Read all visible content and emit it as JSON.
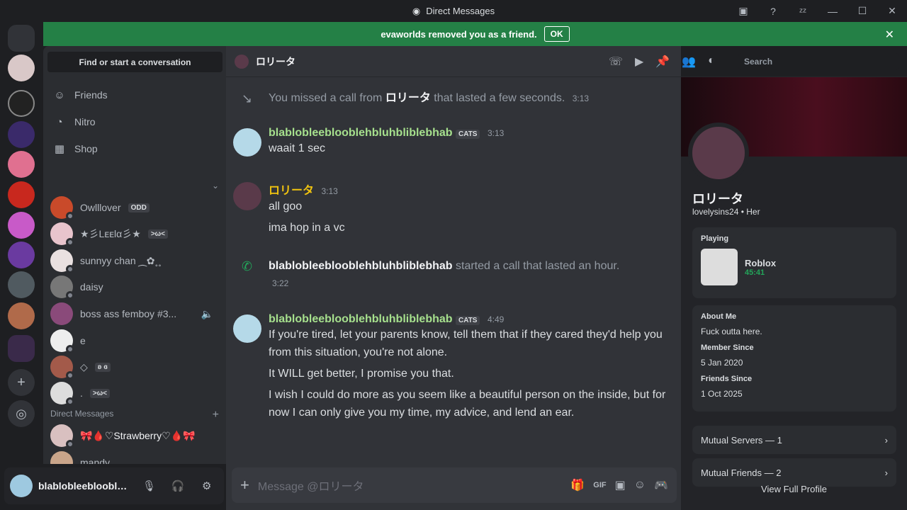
{
  "window": {
    "title": "Direct Messages"
  },
  "banner": {
    "text": "evaworlds removed you as a friend.",
    "ok": "OK"
  },
  "sidebar": {
    "search": "Find or start a conversation",
    "nav": [
      {
        "label": "Friends",
        "icon": "friends-icon"
      },
      {
        "label": "Nitro",
        "icon": "nitro-icon"
      },
      {
        "label": "Shop",
        "icon": "shop-icon"
      }
    ],
    "section_label": "Direct Messages",
    "friends": [
      {
        "name": "Owlllover",
        "tag": "ODD",
        "color": "#c94a2a"
      },
      {
        "name": "★彡Lᴇᴇlα彡★",
        "tag": ">ω<",
        "color": "#e8c4cc"
      },
      {
        "name": "sunnyy chan ⁔✿˳˳",
        "tag": "",
        "color": "#e9e0e0"
      },
      {
        "name": "daisy",
        "tag": "",
        "color": "#777"
      },
      {
        "name": "boss ass femboy #3...",
        "tag": "",
        "color": "#8a4a7a"
      },
      {
        "name": "e",
        "tag": "",
        "color": "#eee"
      },
      {
        "name": "◇",
        "tag": "ʚ ɞ",
        "color": "#a35a4a"
      },
      {
        "name": ".",
        "tag": ">ω<",
        "color": "#ddd"
      },
      {
        "name": "🎀🩸♡Strawberry♡🩸🎀",
        "tag": "",
        "color": "#d9c0c0"
      },
      {
        "name": "mandy",
        "tag": "",
        "color": "#c9a58a"
      }
    ]
  },
  "user_panel": {
    "name": "blablobleeblooblehbluhbliblebhab"
  },
  "chat": {
    "header_name": "ロリータ",
    "search_placeholder": "Search",
    "missed_call": {
      "prefix": "You missed a call from",
      "name": "ロリータ",
      "suffix": "that lasted a few seconds.",
      "time": "3:13"
    },
    "msg1": {
      "author": "blablobleeblooblehbluhbliblebhab",
      "badge": "CATS",
      "time": "3:13",
      "lines": [
        "waait 1 sec"
      ]
    },
    "msg2": {
      "author": "ロリータ",
      "time": "3:13",
      "lines": [
        "all goo",
        "ima hop in a vc"
      ]
    },
    "call": {
      "name": "blablobleeblooblehbluhbliblebhab",
      "suffix": "started a call that lasted an hour.",
      "time": "3:22"
    },
    "msg3": {
      "author": "blablobleeblooblehbluhbliblebhab",
      "badge": "CATS",
      "time": "4:49",
      "lines": [
        "If you're tired, let your parents know, tell them that if they cared they'd help you from this situation, you're not alone.",
        "It WILL get better, I promise you that.",
        "I wish I could do more as you seem like a beautiful person on the inside, but for now I can only give you my time, my advice, and lend an ear."
      ]
    },
    "composer_placeholder": "Message @ロリータ"
  },
  "profile": {
    "display_name": "ロリータ",
    "username": "lovelysins24",
    "pronouns": "Her",
    "playing_label": "Playing",
    "game": "Roblox",
    "game_time": "45:41",
    "about_label": "About Me",
    "about": "Fuck outta here.",
    "member_since_label": "Member Since",
    "member_since": "5 Jan 2020",
    "friends_since_label": "Friends Since",
    "friends_since": "1 Oct 2025",
    "mutual_servers": "Mutual Servers — 1",
    "mutual_friends": "Mutual Friends — 2",
    "view_full": "View Full Profile"
  },
  "colors": {
    "accent": "#248046",
    "name_green": "#a6e08d",
    "name_yellow": "#f1c40f"
  }
}
